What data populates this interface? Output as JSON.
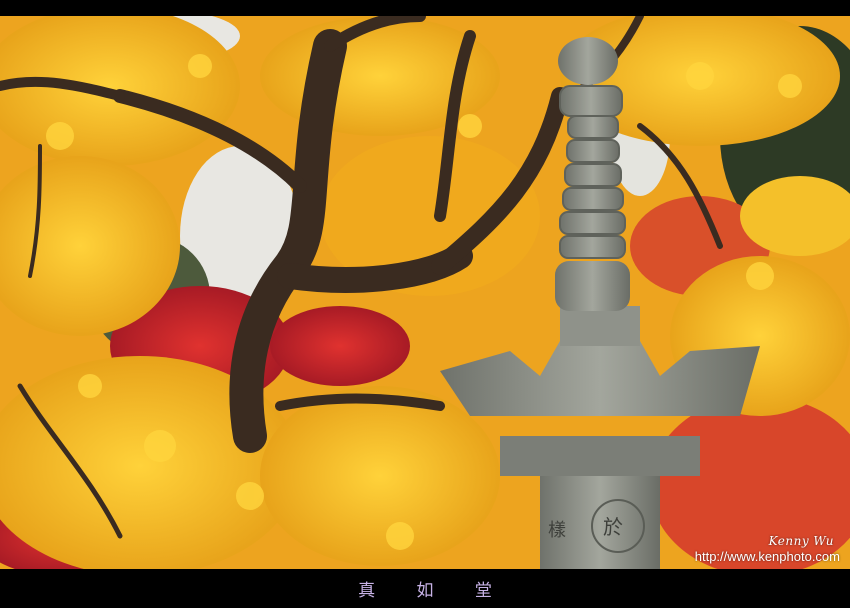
{
  "photo": {
    "subject": "stone-lantern-autumn-maple",
    "colors": {
      "foliage_yellow": "#f2b81a",
      "foliage_orange": "#e9861c",
      "foliage_red": "#c9252c",
      "trunk": "#3b2c22",
      "stone": "#8c8f86",
      "sky": "#e6e6e2"
    }
  },
  "watermark": {
    "name": "Kenny Wu",
    "url": "http://www.kenphoto.com"
  },
  "caption": {
    "title": "真 如 堂"
  }
}
